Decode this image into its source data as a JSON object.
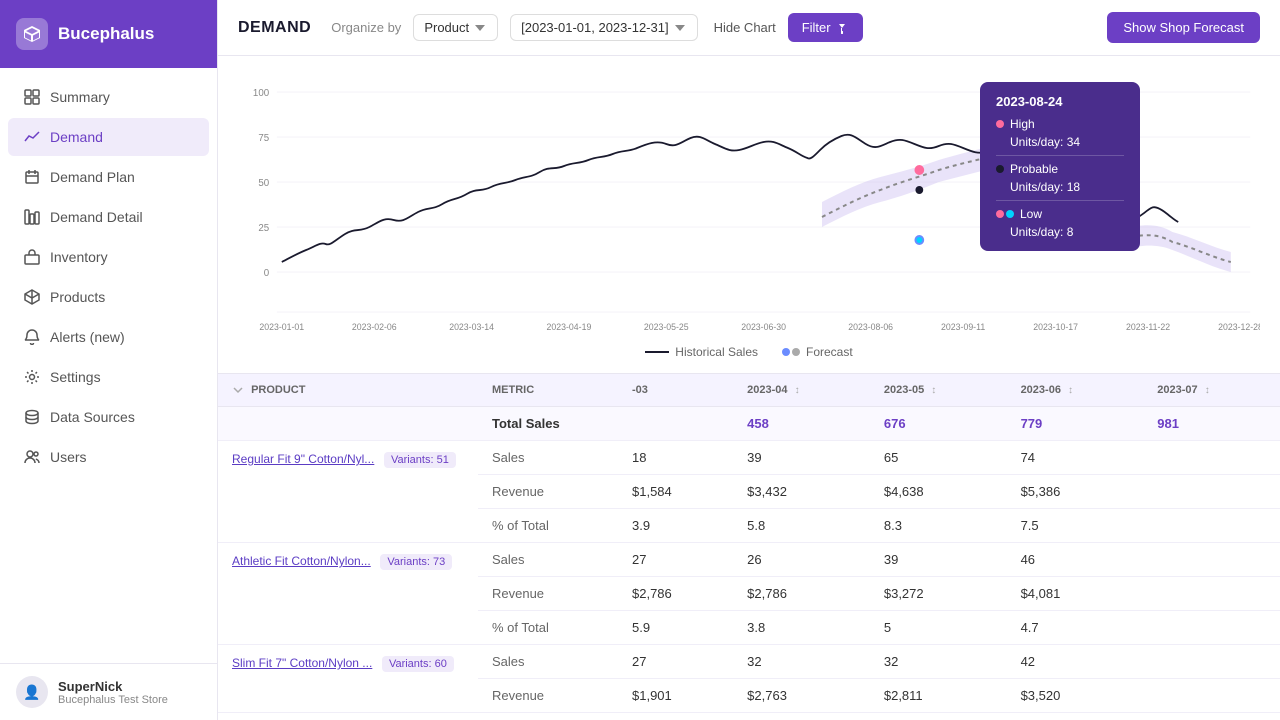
{
  "sidebar": {
    "logo": {
      "text": "Bucephalus"
    },
    "items": [
      {
        "id": "summary",
        "label": "Summary",
        "icon": "grid"
      },
      {
        "id": "demand",
        "label": "Demand",
        "icon": "trending-up",
        "active": true
      },
      {
        "id": "demand-plan",
        "label": "Demand Plan",
        "icon": "calendar"
      },
      {
        "id": "demand-detail",
        "label": "Demand Detail",
        "icon": "bar-chart"
      },
      {
        "id": "inventory",
        "label": "Inventory",
        "icon": "box"
      },
      {
        "id": "products",
        "label": "Products",
        "icon": "tag"
      },
      {
        "id": "alerts",
        "label": "Alerts (new)",
        "icon": "bell"
      },
      {
        "id": "settings",
        "label": "Settings",
        "icon": "settings"
      },
      {
        "id": "data-sources",
        "label": "Data Sources",
        "icon": "database"
      },
      {
        "id": "users",
        "label": "Users",
        "icon": "users"
      }
    ],
    "user": {
      "name": "SuperNick",
      "store": "Bucephalus Test Store"
    }
  },
  "topbar": {
    "title": "DEMAND",
    "organize_label": "Organize by",
    "organize_value": "Product",
    "date_range": "[2023-01-01, 2023-12-31]",
    "hide_chart": "Hide Chart",
    "filter": "Filter",
    "show_forecast": "Show Shop Forecast"
  },
  "chart": {
    "y_labels": [
      "100",
      "75",
      "50",
      "25",
      "0"
    ],
    "x_labels": [
      "2023-01-01",
      "2023-02-06",
      "2023-03-14",
      "2023-04-19",
      "2023-05-25",
      "2023-06-30",
      "2023-08-06",
      "2023-09-11",
      "2023-10-17",
      "2023-11-22",
      "2023-12-28"
    ],
    "legend": {
      "historical": "Historical Sales",
      "forecast": "Forecast"
    },
    "tooltip": {
      "date": "2023-08-24",
      "high_label": "High",
      "high_value": "Units/day: 34",
      "probable_label": "Probable",
      "probable_value": "Units/day: 18",
      "low_label": "Low",
      "low_value": "Units/day: 8"
    }
  },
  "table": {
    "columns": [
      {
        "id": "product",
        "label": "PRODUCT"
      },
      {
        "id": "metric",
        "label": "METRIC"
      },
      {
        "id": "col_03",
        "label": "-03"
      },
      {
        "id": "col_04",
        "label": "2023-04"
      },
      {
        "id": "col_05",
        "label": "2023-05"
      },
      {
        "id": "col_06",
        "label": "2023-06"
      },
      {
        "id": "col_07",
        "label": "2023-07"
      }
    ],
    "total_row": {
      "label": "Total Sales",
      "col_03": "",
      "col_04": "458",
      "col_05": "676",
      "col_06": "779",
      "col_07": "981"
    },
    "products": [
      {
        "name": "Regular Fit 9\" Cotton/Nyl...",
        "variants": "Variants: 51",
        "rows": [
          {
            "metric": "Sales",
            "col_03": "18",
            "col_04": "39",
            "col_05": "65",
            "col_06": "74"
          },
          {
            "metric": "Revenue",
            "col_03": "$1,584",
            "col_04": "$3,432",
            "col_05": "$4,638",
            "col_06": "$5,386"
          },
          {
            "metric": "% of Total",
            "col_03": "3.9",
            "col_04": "5.8",
            "col_05": "8.3",
            "col_06": "7.5"
          }
        ]
      },
      {
        "name": "Athletic Fit Cotton/Nylon...",
        "variants": "Variants: 73",
        "rows": [
          {
            "metric": "Sales",
            "col_03": "27",
            "col_04": "26",
            "col_05": "39",
            "col_06": "46"
          },
          {
            "metric": "Revenue",
            "col_03": "$2,786",
            "col_04": "$2,786",
            "col_05": "$3,272",
            "col_06": "$4,081"
          },
          {
            "metric": "% of Total",
            "col_03": "5.9",
            "col_04": "3.8",
            "col_05": "5",
            "col_06": "4.7"
          }
        ]
      },
      {
        "name": "Slim Fit 7\" Cotton/Nylon ...",
        "variants": "Variants: 60",
        "rows": [
          {
            "metric": "Sales",
            "col_03": "27",
            "col_04": "32",
            "col_05": "32",
            "col_06": "42"
          },
          {
            "metric": "Revenue",
            "col_03": "$1,901",
            "col_04": "$2,763",
            "col_05": "$2,811",
            "col_06": "$3,520"
          }
        ]
      }
    ]
  }
}
